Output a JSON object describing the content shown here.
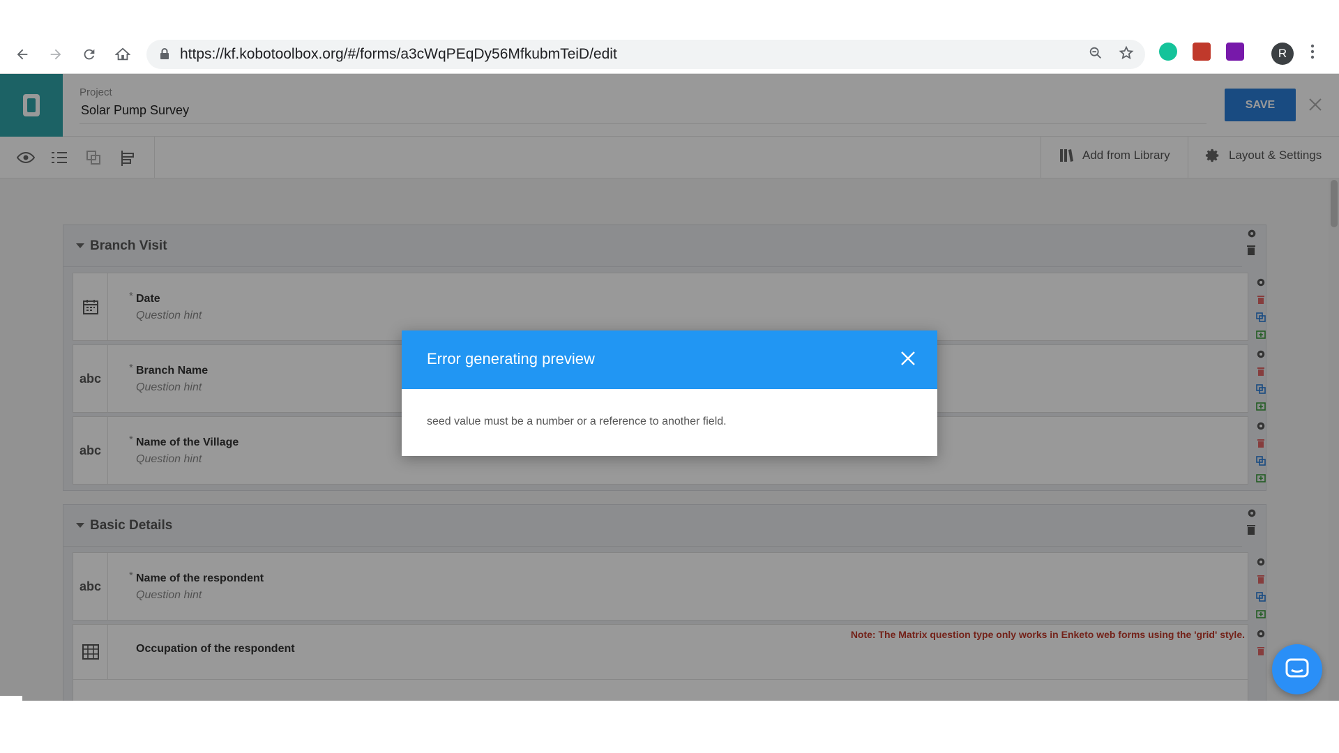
{
  "browser": {
    "url": "https://kf.kobotoolbox.org/#/forms/a3cWqPEqDy56MfkubmTeiD/edit",
    "avatar_letter": "R"
  },
  "header": {
    "project_label": "Project",
    "project_name": "Solar Pump Survey",
    "save_label": "SAVE"
  },
  "form_toolbar": {
    "add_from_library": "Add from Library",
    "layout_settings": "Layout & Settings"
  },
  "groups": [
    {
      "title": "Branch Visit",
      "rows": [
        {
          "type_icon": "calendar-icon",
          "label": "Date",
          "hint": "Question hint",
          "required": "*"
        },
        {
          "type_text": "abc",
          "label": "Branch Name",
          "hint": "Question hint",
          "required": "*"
        },
        {
          "type_text": "abc",
          "label": "Name of the Village",
          "hint": "Question hint",
          "required": "*"
        }
      ]
    },
    {
      "title": "Basic Details",
      "rows": [
        {
          "type_text": "abc",
          "label": "Name of the respondent",
          "hint": "Question hint",
          "required": "*"
        },
        {
          "type_icon": "table-icon",
          "label": "Occupation of the respondent",
          "note": "Note: The Matrix question type only works in Enketo web forms using the 'grid' style."
        }
      ]
    }
  ],
  "modal": {
    "title": "Error generating preview",
    "message": "seed value must be a number or a reference to another field."
  },
  "colors": {
    "accent": "#2196f3",
    "save": "#2b7dd8",
    "logo_bg": "#2fa4a9",
    "note": "#c0392b"
  }
}
